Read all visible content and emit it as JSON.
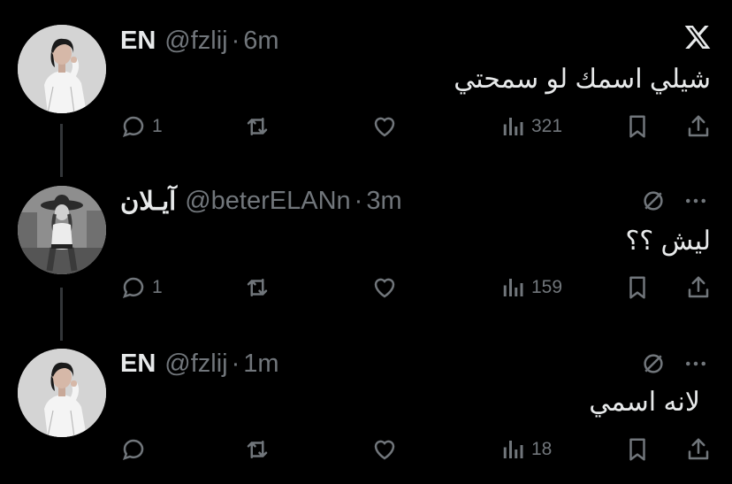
{
  "platform_logo": "x-logo",
  "tweets": [
    {
      "name": "EN",
      "handle": "@fzlij",
      "separator": "·",
      "time": "6m",
      "text": "شيلي اسمك لو سمحتي",
      "replies": "1",
      "views": "321",
      "avatar": "woman-in-white-shirt-avatar"
    },
    {
      "name": "آيـلان",
      "handle": "@beterELANn",
      "separator": "·",
      "time": "3m",
      "text": "ليش ؟؟",
      "replies": "1",
      "views": "159",
      "avatar": "cowgirl-avatar"
    },
    {
      "name": "EN",
      "handle": "@fzlij",
      "separator": "·",
      "time": "1m",
      "text": "لانه اسمي",
      "replies": "",
      "views": "18",
      "avatar": "woman-in-white-shirt-avatar"
    }
  ],
  "colors": {
    "background": "#000000",
    "text": "#e7e9ea",
    "muted": "#71767b",
    "thread_line": "#333639"
  }
}
